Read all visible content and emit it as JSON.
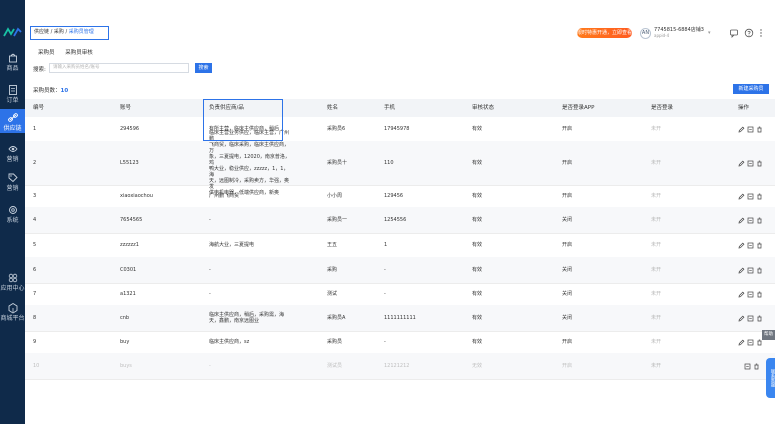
{
  "sidebar": {
    "items": [
      {
        "label": "商品",
        "icon": "bag-icon"
      },
      {
        "label": "订单",
        "icon": "order-icon"
      },
      {
        "label": "供应链",
        "icon": "link-icon"
      },
      {
        "label": "营销",
        "icon": "marketing-icon"
      },
      {
        "label": "营销",
        "icon": "tag-icon"
      },
      {
        "label": "系统",
        "icon": "gear-icon"
      },
      {
        "label": "应用中心",
        "icon": "apps-icon"
      },
      {
        "label": "商城平台",
        "icon": "store-icon"
      }
    ],
    "active_index": 2
  },
  "breadcrumb": {
    "a": "供应链",
    "sep": "/",
    "b": "采购",
    "c": "采购员管理"
  },
  "header": {
    "promo": "限时特惠开通，立即查看",
    "avatar": "AN",
    "account_name": "7745815-6884店铺3",
    "account_sub": "appid-4",
    "dropdown": "▾"
  },
  "tabs": [
    "采购员",
    "采购员审核"
  ],
  "search": {
    "label": "搜索:",
    "placeholder": "请输入采购员姓名/账号",
    "button": "搜索"
  },
  "summary": {
    "label": "采购员数：",
    "count": "10"
  },
  "new_button": "新建采购员",
  "table": {
    "headers": [
      "编号",
      "账号",
      "负责供应商/品",
      "姓名",
      "手机",
      "审核状态",
      "是否登录APP",
      "是否登录",
      "操作"
    ],
    "rows": [
      {
        "no": "1",
        "account": "294596",
        "pos": [
          "有所主营，临床主供应商，稍后"
        ],
        "name": "采购员6",
        "phone": "17945978",
        "status": "有效",
        "app": "开启",
        "pad": "未开"
      },
      {
        "no": "2",
        "account": "L55123",
        "pos": [
          "临床主营业务供应，临床主营，广州鹏",
          "飞商贸，临床采购，临床主供应商，万",
          "象，三夏提电，12020，南京普洛，鸡",
          "鸭大业，稳业供应，zzzzz，1，1，海",
          "天，远图制冷，采购卖方，华强，奥发",
          "供电机电器，低端供应商，新奥"
        ],
        "name": "采购员十",
        "phone": "110",
        "status": "有效",
        "app": "开启",
        "pad": "未开"
      },
      {
        "no": "3",
        "account": "xiaoxiaochou",
        "pos": [
          "广州鹏飞商贸"
        ],
        "name": "小小周",
        "phone": "129456",
        "status": "有效",
        "app": "开启",
        "pad": "未开"
      },
      {
        "no": "4",
        "account": "7654565",
        "pos": [
          "-"
        ],
        "name": "采购员一",
        "phone": "1254556",
        "status": "有效",
        "app": "关闭",
        "pad": "未开"
      },
      {
        "no": "5",
        "account": "zzzzzz1",
        "pos": [
          "海航大业，三夏提电"
        ],
        "name": "王五",
        "phone": "1",
        "status": "有效",
        "app": "开启",
        "pad": "未开"
      },
      {
        "no": "6",
        "account": "C0301",
        "pos": [
          "-"
        ],
        "name": "采购",
        "phone": "-",
        "status": "有效",
        "app": "关闭",
        "pad": "未开"
      },
      {
        "no": "7",
        "account": "a1321",
        "pos": [
          "-"
        ],
        "name": "测试",
        "phone": "-",
        "status": "有效",
        "app": "关闭",
        "pad": "未开"
      },
      {
        "no": "8",
        "account": "cnb",
        "pos": [
          "临床主供应商，稍后，采购需，海",
          "天，鑫鹏，南京远图业"
        ],
        "name": "采购员A",
        "phone": "1111111111",
        "status": "有效",
        "app": "关闭",
        "pad": "未开"
      },
      {
        "no": "9",
        "account": "buy",
        "pos": [
          "临床主供应商，sz"
        ],
        "name": "采购员",
        "phone": "-",
        "status": "有效",
        "app": "开启",
        "pad": "未开"
      },
      {
        "no": "10",
        "account": "buys",
        "pos": [
          "-"
        ],
        "name": "测试员",
        "phone": "12121212",
        "status": "无效",
        "app": "开启",
        "pad": "未开"
      }
    ]
  },
  "floating": {
    "btn1": "帮助",
    "btn2": "联系客服"
  },
  "colors": {
    "sidebar": "#0f2a4a",
    "accent": "#2d73e8",
    "promo": "#ff6a1f"
  }
}
